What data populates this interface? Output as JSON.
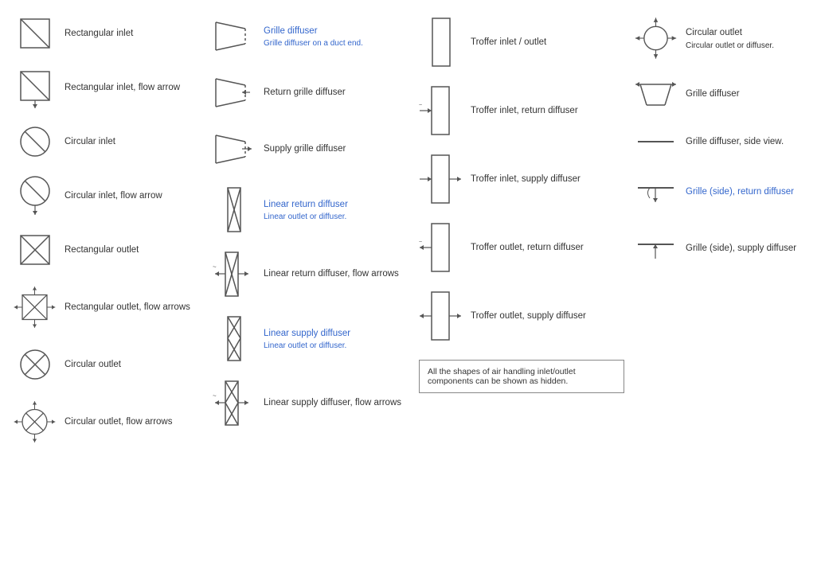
{
  "items": [
    {
      "col": 0,
      "label": "Rectangular inlet",
      "sublabel": "",
      "symbol": "rect_inlet"
    },
    {
      "col": 0,
      "label": "Rectangular inlet, flow arrow",
      "sublabel": "",
      "symbol": "rect_inlet_flow"
    },
    {
      "col": 0,
      "label": "Circular inlet",
      "sublabel": "",
      "symbol": "circ_inlet"
    },
    {
      "col": 0,
      "label": "Circular inlet, flow arrow",
      "sublabel": "",
      "symbol": "circ_inlet_flow"
    },
    {
      "col": 0,
      "label": "Rectangular outlet",
      "sublabel": "",
      "symbol": "rect_outlet"
    },
    {
      "col": 0,
      "label": "Rectangular outlet, flow arrows",
      "sublabel": "",
      "symbol": "rect_outlet_flow"
    },
    {
      "col": 0,
      "label": "Circular outlet",
      "sublabel": "",
      "symbol": "circ_outlet"
    },
    {
      "col": 0,
      "label": "Circular outlet, flow arrows",
      "sublabel": "",
      "symbol": "circ_outlet_flow"
    },
    {
      "col": 1,
      "label": "Grille diffuser",
      "sublabel": "Grille diffuser on a duct end.",
      "symbol": "grille_diff",
      "blue": true
    },
    {
      "col": 1,
      "label": "Return grille diffuser",
      "sublabel": "",
      "symbol": "return_grille_diff"
    },
    {
      "col": 1,
      "label": "Supply grille diffuser",
      "sublabel": "",
      "symbol": "supply_grille_diff"
    },
    {
      "col": 1,
      "label": "Linear return diffuser",
      "sublabel": "Linear outlet or diffuser.",
      "symbol": "linear_return",
      "blue": true
    },
    {
      "col": 1,
      "label": "Linear return diffuser, flow arrows",
      "sublabel": "",
      "symbol": "linear_return_flow"
    },
    {
      "col": 1,
      "label": "Linear supply diffuser",
      "sublabel": "Linear outlet or diffuser.",
      "symbol": "linear_supply",
      "blue": true
    },
    {
      "col": 1,
      "label": "Linear supply diffuser, flow arrows",
      "sublabel": "",
      "symbol": "linear_supply_flow"
    },
    {
      "col": 2,
      "label": "Troffer inlet / outlet",
      "sublabel": "",
      "symbol": "troffer_io"
    },
    {
      "col": 2,
      "label": "Troffer inlet, return diffuser",
      "sublabel": "",
      "symbol": "troffer_inlet_ret"
    },
    {
      "col": 2,
      "label": "Troffer inlet, supply diffuser",
      "sublabel": "",
      "symbol": "troffer_inlet_sup"
    },
    {
      "col": 2,
      "label": "Troffer outlet, return diffuser",
      "sublabel": "",
      "symbol": "troffer_outlet_ret"
    },
    {
      "col": 2,
      "label": "Troffer outlet, supply diffuser",
      "sublabel": "",
      "symbol": "troffer_outlet_sup"
    },
    {
      "col": 3,
      "label": "Circular outlet or diffuser.",
      "sublabel": "",
      "symbol": "circ_outlet_diff",
      "header": "Circular outlet"
    },
    {
      "col": 3,
      "label": "Grille diffuser",
      "sublabel": "",
      "symbol": "grille_diff2"
    },
    {
      "col": 3,
      "label": "Grille diffuser, side view.",
      "sublabel": "",
      "symbol": "grille_side"
    },
    {
      "col": 3,
      "label": "Grille (side), return diffuser",
      "sublabel": "",
      "symbol": "grille_side_ret",
      "blue": true
    },
    {
      "col": 3,
      "label": "Grille (side), supply diffuser",
      "sublabel": "",
      "symbol": "grille_side_sup"
    }
  ],
  "note": "All the shapes of air handling inlet/outlet components can be shown as hidden."
}
